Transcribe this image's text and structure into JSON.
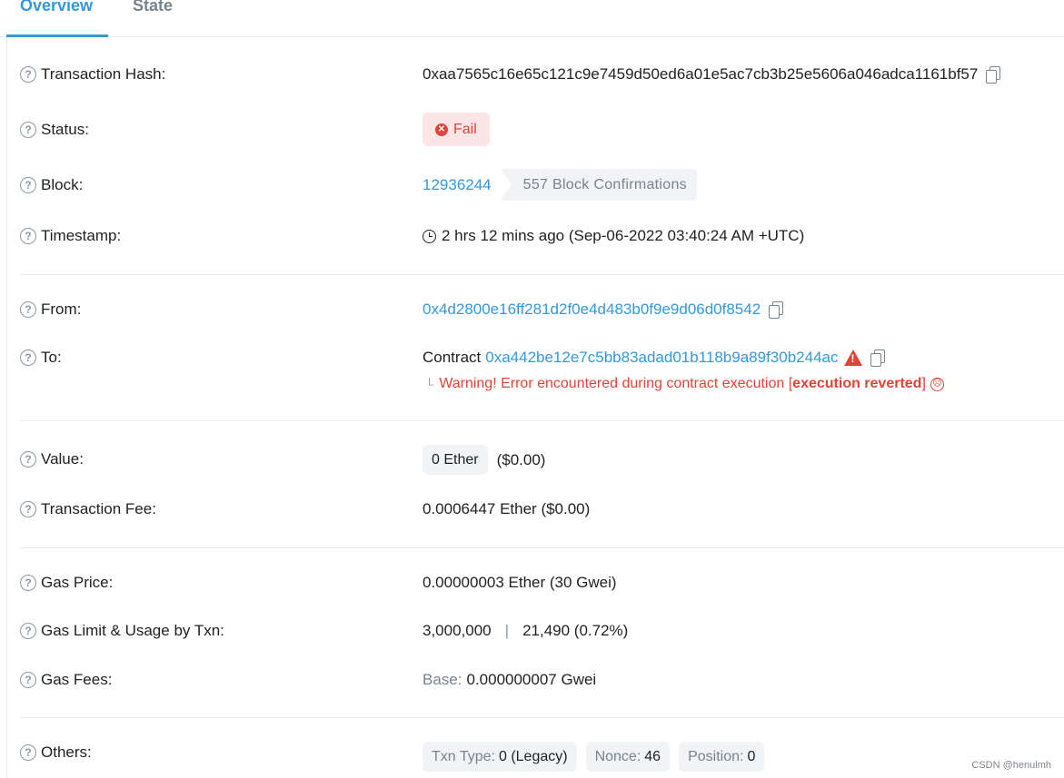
{
  "tabs": [
    {
      "label": "Overview",
      "active": true
    },
    {
      "label": "State",
      "active": false
    }
  ],
  "rows": {
    "tx_hash": {
      "label": "Transaction Hash:",
      "value": "0xaa7565c16e65c121c9e7459d50ed6a01e5ac7cb3b25e5606a046adca1161bf57"
    },
    "status": {
      "label": "Status:",
      "value": "Fail"
    },
    "block": {
      "label": "Block:",
      "number": "12936244",
      "confirmations": "557 Block Confirmations"
    },
    "timestamp": {
      "label": "Timestamp:",
      "value": "2 hrs 12 mins ago (Sep-06-2022 03:40:24 AM +UTC)"
    },
    "from": {
      "label": "From:",
      "value": "0x4d2800e16ff281d2f0e4d483b0f9e9d06d0f8542"
    },
    "to": {
      "label": "To:",
      "prefix": "Contract",
      "address": "0xa442be12e7c5bb83adad01b118b9a89f30b244ac",
      "warning_prefix": "Warning! Error encountered during contract execution [",
      "warning_bold": "execution reverted",
      "warning_suffix": "]"
    },
    "value": {
      "label": "Value:",
      "amount": "0 Ether",
      "usd": "($0.00)"
    },
    "tx_fee": {
      "label": "Transaction Fee:",
      "value": "0.0006447 Ether ($0.00)"
    },
    "gas_price": {
      "label": "Gas Price:",
      "value": "0.00000003 Ether (30 Gwei)"
    },
    "gas_limit": {
      "label": "Gas Limit & Usage by Txn:",
      "limit": "3,000,000",
      "separator": "|",
      "usage": "21,490 (0.72%)"
    },
    "gas_fees": {
      "label": "Gas Fees:",
      "base_label": "Base:",
      "base_value": "0.000000007 Gwei"
    },
    "others": {
      "label": "Others:",
      "txn_type_label": "Txn Type:",
      "txn_type_value": "0 (Legacy)",
      "nonce_label": "Nonce:",
      "nonce_value": "46",
      "position_label": "Position:",
      "position_value": "0"
    }
  },
  "watermark": "CSDN @henulmh",
  "colors": {
    "link": "#3498db",
    "error": "#de4437",
    "muted": "#77838f"
  }
}
